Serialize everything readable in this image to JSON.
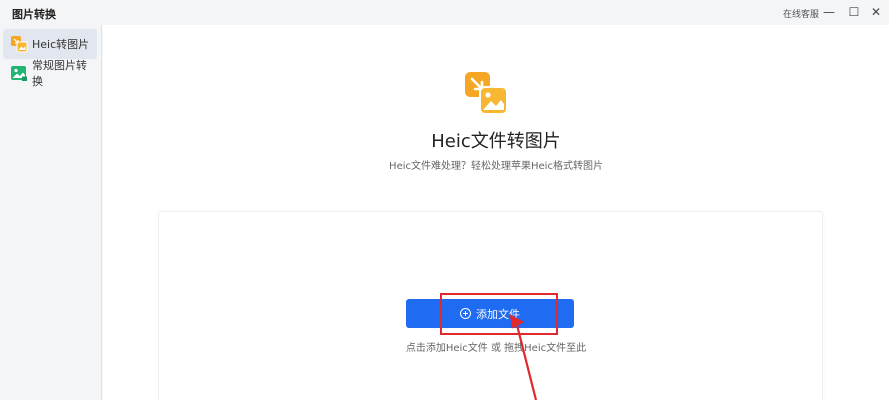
{
  "window": {
    "title": "图片转换",
    "support_label": "在线客服",
    "controls": {
      "minimize": "—",
      "maximize": "☐",
      "close": "✕"
    }
  },
  "sidebar": {
    "items": [
      {
        "label": "Heic转图片",
        "icon": "heic-convert-icon",
        "active": true
      },
      {
        "label": "常规图片转换",
        "icon": "image-convert-icon",
        "active": false
      }
    ]
  },
  "main": {
    "title": "Heic文件转图片",
    "subtitle": "Heic文件难处理？轻松处理苹果Heic格式转图片",
    "add_button_label": "添加文件",
    "hint": "点击添加Heic文件 或 拖拽Heic文件至此"
  },
  "colors": {
    "accent": "#1f6bf2",
    "icon_orange": "#f5a623",
    "icon_green": "#22b573",
    "annotation_red": "#e0282d"
  }
}
